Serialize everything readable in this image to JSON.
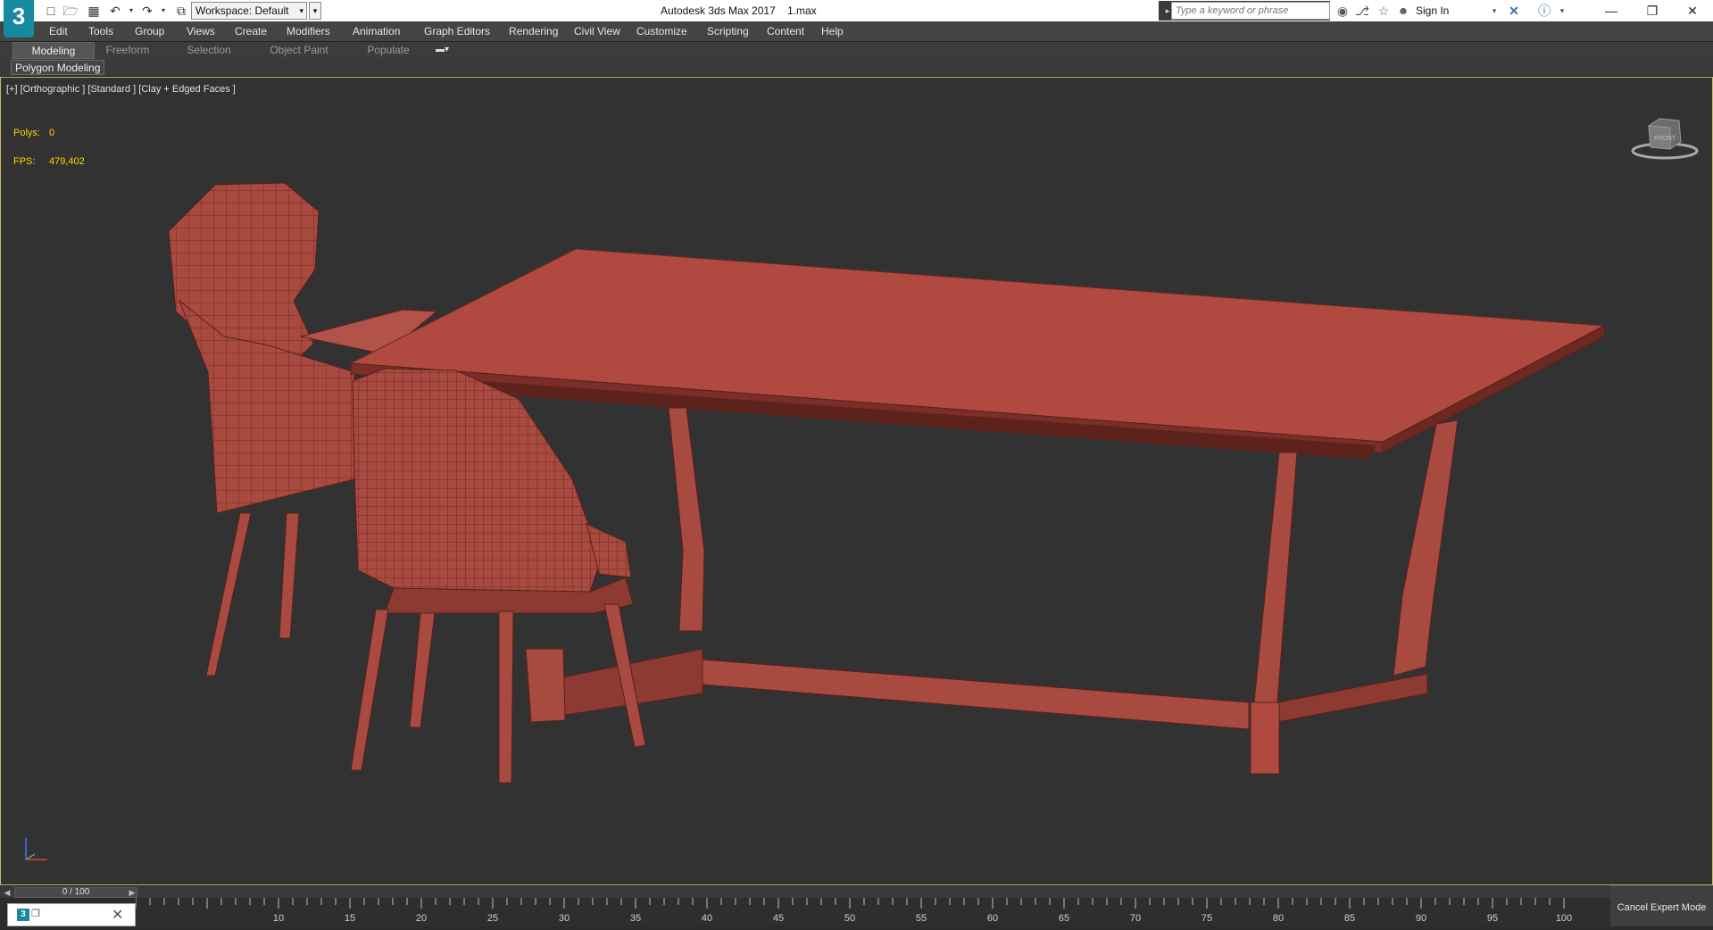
{
  "titlebar": {
    "logo_text": "3",
    "workspace": "Workspace: Default",
    "app_title": "Autodesk 3ds Max 2017",
    "file_name": "1.max",
    "search_placeholder": "Type a keyword or phrase",
    "sign_in": "Sign In",
    "icons": [
      "new-file-icon",
      "open-file-icon",
      "save-icon",
      "undo-icon",
      "redo-icon",
      "project-folder-icon",
      "binoculars-icon",
      "subscription-icon",
      "favorites-star-icon",
      "user-icon",
      "exchange-x-icon",
      "help-icon"
    ]
  },
  "menu": [
    "Edit",
    "Tools",
    "Group",
    "Views",
    "Create",
    "Modifiers",
    "Animation",
    "Graph Editors",
    "Rendering",
    "Civil View",
    "Customize",
    "Scripting",
    "Content",
    "Help"
  ],
  "ribbon": {
    "tabs": [
      "Modeling",
      "Freeform",
      "Selection",
      "Object Paint",
      "Populate"
    ],
    "active_tab": "Modeling",
    "panel_label": "Polygon Modeling"
  },
  "viewport": {
    "label": "[+] [Orthographic ] [Standard ] [Clay + Edged Faces ]",
    "stats": {
      "polys_label": "Polys:",
      "polys_value": "0",
      "fps_label": "FPS:",
      "fps_value": "479,402"
    },
    "viewcube_face": "FRONT",
    "model_color": "#a84a40",
    "border_color": "#c9b96a"
  },
  "timeline": {
    "frame_display": "0 / 100",
    "ticks": [
      "10",
      "15",
      "20",
      "25",
      "30",
      "35",
      "40",
      "45",
      "50",
      "55",
      "60",
      "65",
      "70",
      "75",
      "80",
      "85",
      "90",
      "95",
      "100"
    ],
    "tick_min": 0,
    "tick_max": 100
  },
  "status": {
    "cancel_expert": "Cancel Expert Mode"
  }
}
